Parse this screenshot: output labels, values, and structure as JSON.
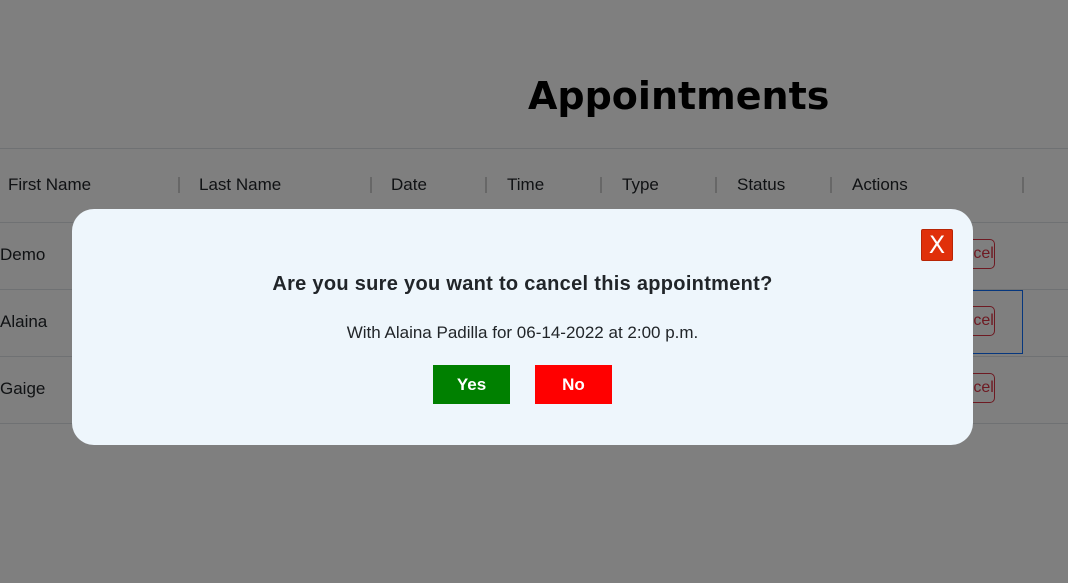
{
  "page": {
    "title": "Appointments"
  },
  "table": {
    "columns": [
      "First Name",
      "Last Name",
      "Date",
      "Time",
      "Type",
      "Status",
      "Actions"
    ],
    "rows": [
      {
        "first_name": "Demo",
        "action_label": "Cancel"
      },
      {
        "first_name": "Alaina",
        "action_label": "Cancel"
      },
      {
        "first_name": "Gaige",
        "action_label": "Cancel"
      }
    ]
  },
  "modal": {
    "close_label": "X",
    "question": "Are you sure you want to cancel this appointment?",
    "detail": "With Alaina Padilla for 06-14-2022 at 2:00 p.m.",
    "yes_label": "Yes",
    "no_label": "No"
  },
  "colors": {
    "yes_button": "#008000",
    "no_button": "#ff0000",
    "close_button": "#e0300a",
    "modal_background": "#eef6fc",
    "overlay": "rgba(0,0,0,0.5)"
  }
}
